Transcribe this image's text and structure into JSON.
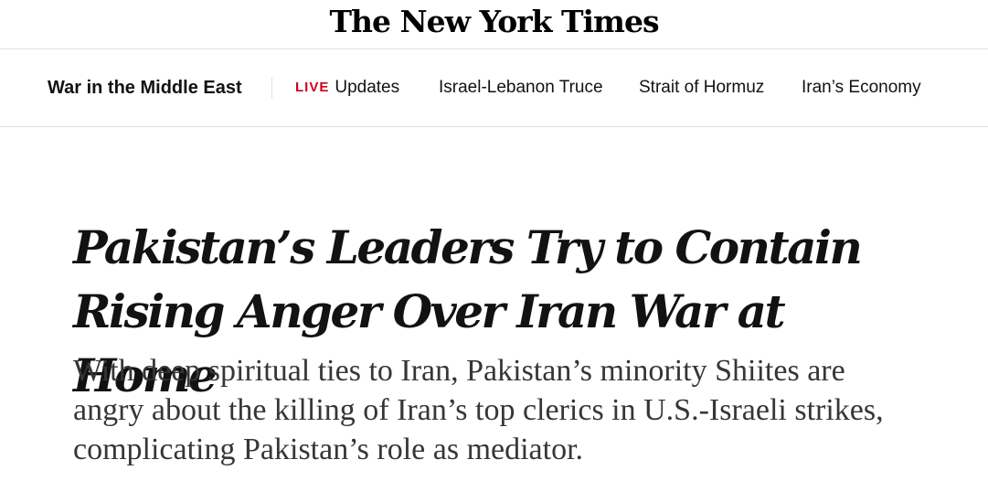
{
  "masthead": {
    "logo_text": "The New York Times"
  },
  "nav": {
    "section_title": "War in the Middle East",
    "live_tag": "LIVE",
    "links": [
      {
        "label": "Updates"
      },
      {
        "label": "Israel-Lebanon Truce"
      },
      {
        "label": "Strait of Hormuz"
      },
      {
        "label": "Iran’s Economy"
      }
    ],
    "live_color": "#d0021b"
  },
  "article": {
    "headline": "Pakistan’s Leaders Try to Contain Rising Anger Over Iran War at Home",
    "summary": "With deep spiritual ties to Iran, Pakistan’s minority Shiites are angry about the killing of Iran’s top clerics in U.S.-Israeli strikes, complicating Pakistan’s role as mediator."
  }
}
